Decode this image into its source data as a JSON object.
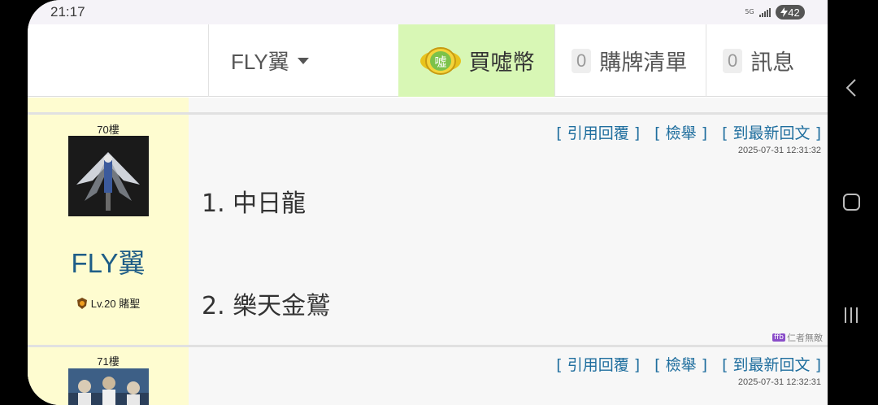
{
  "status": {
    "time": "21:17",
    "network": "5G",
    "battery": "42"
  },
  "nav": {
    "user": "FLY翼",
    "coin_label": "買噓幣",
    "coin_icon_text": "噓",
    "list_count": "0",
    "list_label": "購牌清單",
    "msg_count": "0",
    "msg_label": "訊息"
  },
  "posts": [
    {
      "floor": "70樓",
      "username": "FLY翼",
      "level": "Lv.20 賭聖",
      "actions": [
        "引用回覆",
        "檢舉",
        "到最新回文"
      ],
      "time": "2025-07-31 12:31:32",
      "lines": [
        "1. 中日龍",
        "2. 樂天金鷲"
      ],
      "signature_tag": "ffb",
      "signature": "仁者無敵"
    },
    {
      "floor": "71樓",
      "actions": [
        "引用回覆",
        "檢舉",
        "到最新回文"
      ],
      "time": "2025-07-31 12:32:31"
    }
  ],
  "colors": {
    "accent_link": "#1f6e9e",
    "coin_bg": "#d8f7b5",
    "user_col": "#fefcd0",
    "username": "#1e5d87"
  },
  "icons": {
    "back": "back-chevron-icon",
    "home": "home-icon",
    "recent": "recent-apps-icon",
    "caret": "caret-down-icon"
  }
}
